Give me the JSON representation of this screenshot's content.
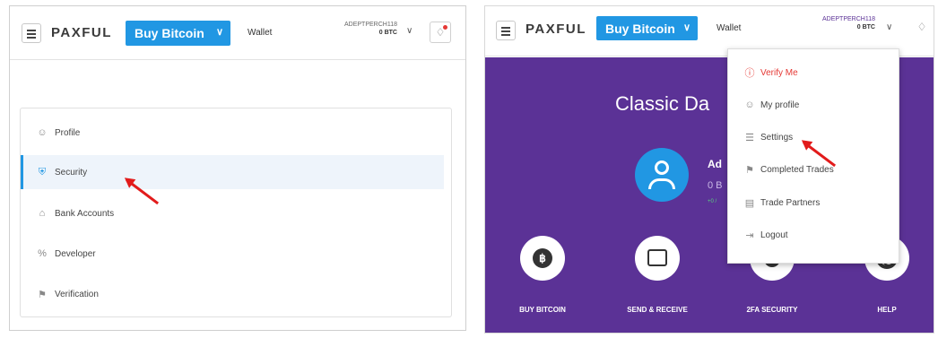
{
  "left": {
    "topbar": {
      "logo": "PAXFUL",
      "buy_label": "Buy Bitcoin",
      "wallet": "Wallet",
      "username": "ADEPTPERCH118",
      "balance": "0 BTC"
    },
    "settings_nav": {
      "items": [
        {
          "label": "Profile",
          "icon": "user-icon"
        },
        {
          "label": "Security",
          "icon": "shield-icon",
          "active": true
        },
        {
          "label": "Bank Accounts",
          "icon": "bank-icon"
        },
        {
          "label": "Developer",
          "icon": "code-icon"
        },
        {
          "label": "Verification",
          "icon": "flag-icon"
        }
      ]
    }
  },
  "right": {
    "topbar": {
      "logo": "PAXFUL",
      "buy_label": "Buy Bitcoin",
      "wallet": "Wallet",
      "username": "ADEPTPERCH118",
      "balance": "0 BTC"
    },
    "dashboard": {
      "title": "Classic Da",
      "name": "Ad",
      "balance": "0 B",
      "stat": "+0 /"
    },
    "quick_actions": [
      {
        "label": "BUY BITCOIN",
        "icon": "bitcoin-icon"
      },
      {
        "label": "SEND & RECEIVE",
        "icon": "wallet-icon"
      },
      {
        "label": "2FA SECURITY",
        "icon": "shield-icon"
      },
      {
        "label": "HELP",
        "icon": "lifebuoy-icon"
      }
    ],
    "user_menu": {
      "items": [
        {
          "label": "Verify Me",
          "icon": "alert-icon",
          "warning": true
        },
        {
          "label": "My profile",
          "icon": "user-icon"
        },
        {
          "label": "Settings",
          "icon": "sliders-icon"
        },
        {
          "label": "Completed Trades",
          "icon": "flag-icon"
        },
        {
          "label": "Trade Partners",
          "icon": "contacts-icon"
        },
        {
          "label": "Logout",
          "icon": "logout-icon"
        }
      ]
    }
  },
  "colors": {
    "brand_blue": "#2197e3",
    "dashboard_purple": "#5b3296",
    "annotation_red": "#e21b1b",
    "warning_red": "#e53935"
  }
}
